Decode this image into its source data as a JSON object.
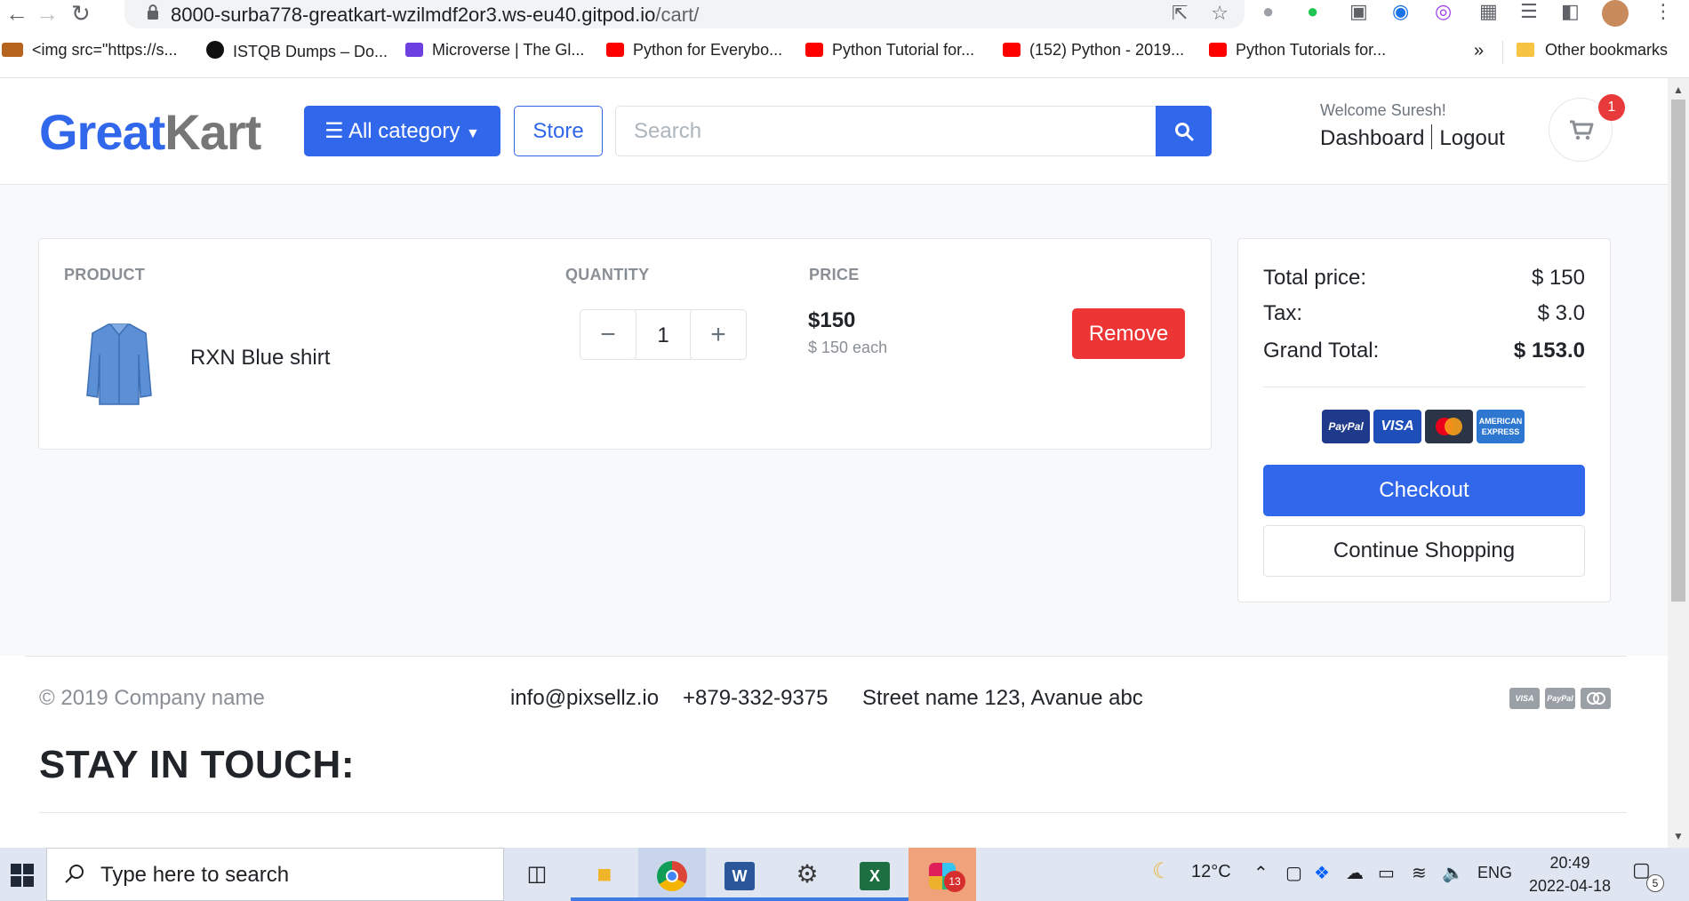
{
  "browser": {
    "url_host": "8000-surba778-greatkart-wzilmdf2or3.ws-eu40.gitpod.io",
    "url_path": "/cart/",
    "bookmarks": [
      {
        "label": "<img src=\"https://s..."
      },
      {
        "label": "ISTQB Dumps – Do..."
      },
      {
        "label": "Microverse | The Gl..."
      },
      {
        "label": "Python for Everybo..."
      },
      {
        "label": "Python Tutorial for..."
      },
      {
        "label": "(152) Python - 2019..."
      },
      {
        "label": "Python Tutorials for..."
      }
    ],
    "more_bookmarks": "»",
    "other_bookmarks": "Other bookmarks"
  },
  "header": {
    "logo_part1": "Great",
    "logo_part2": "Kart",
    "category_button": "All category",
    "store_button": "Store",
    "search_placeholder": "Search",
    "welcome": "Welcome Suresh!",
    "dashboard_link": "Dashboard",
    "logout_link": "Logout",
    "cart_count": "1"
  },
  "cart": {
    "columns": {
      "product": "PRODUCT",
      "quantity": "QUANTITY",
      "price": "PRICE"
    },
    "items": [
      {
        "name": "RXN Blue shirt",
        "quantity": "1",
        "price": "$150",
        "each": "$ 150 each",
        "remove_label": "Remove"
      }
    ],
    "minus": "−",
    "plus": "+"
  },
  "summary": {
    "total_label": "Total price:",
    "total_value": "$ 150",
    "tax_label": "Tax:",
    "tax_value": "$ 3.0",
    "grand_label": "Grand Total:",
    "grand_value": "$ 153.0",
    "payment_methods": [
      "PayPal",
      "VISA",
      "",
      "AMERICAN EXPRESS"
    ],
    "checkout_label": "Checkout",
    "continue_label": "Continue Shopping"
  },
  "footer": {
    "copyright": "© 2019 Company name",
    "email": "info@pixsellz.io",
    "phone": "+879-332-9375",
    "address": "Street name 123, Avanue abc",
    "payment_icons": [
      "VISA",
      "PayPal",
      ""
    ],
    "stay_in_touch": "STAY IN TOUCH:"
  },
  "taskbar": {
    "search_placeholder": "Type here to search",
    "temperature": "12°C",
    "language": "ENG",
    "time": "20:49",
    "date": "2022-04-18",
    "slack_badge": "13",
    "notification_count": "5"
  },
  "colors": {
    "primary": "#3167eb",
    "danger": "#ee3535",
    "badge": "#e83a3a"
  }
}
